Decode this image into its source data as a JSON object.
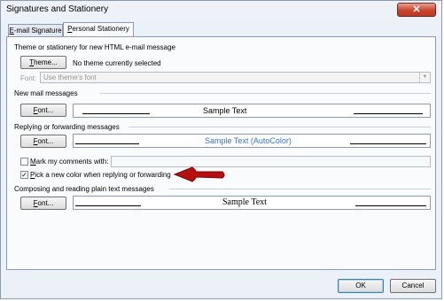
{
  "window": {
    "title": "Signatures and Stationery",
    "close_glyph": "✕"
  },
  "tabs": [
    {
      "label": "E-mail Signature",
      "underline_char": "E",
      "rest": "-mail Signature"
    },
    {
      "label": "Personal Stationery",
      "underline_char": "P",
      "rest": "ersonal Stationery"
    }
  ],
  "theme_section": {
    "label": "Theme or stationery for new HTML e-mail message",
    "theme_button": {
      "u": "T",
      "rest": "heme..."
    },
    "status": "No theme currently selected",
    "font_label": "Font:",
    "font_select_value": "Use theme's font"
  },
  "new_mail": {
    "label": "New mail messages",
    "font_button": {
      "u": "F",
      "rest": "ont..."
    },
    "sample_text": "Sample Text"
  },
  "replying": {
    "label": "Replying or forwarding messages",
    "font_button": {
      "u": "F",
      "rest": "ont..."
    },
    "sample_text": "Sample Text (AutoColor)",
    "sample_color": "#3a6fc4",
    "mark_comments": {
      "u": "M",
      "rest": "ark my comments with:",
      "checked": false
    },
    "pick_color": {
      "u": "P",
      "rest": "ick a new color when replying or forwarding",
      "checked": true
    }
  },
  "plain_text": {
    "label": "Composing and reading plain text messages",
    "font_button": {
      "u": "F",
      "rest": "ont..."
    },
    "sample_text": "Sample Text"
  },
  "footer": {
    "ok_label": "OK",
    "cancel_label": "Cancel"
  },
  "annotation": {
    "color": "#b50f0f",
    "icon": "red-arrow-icon"
  }
}
